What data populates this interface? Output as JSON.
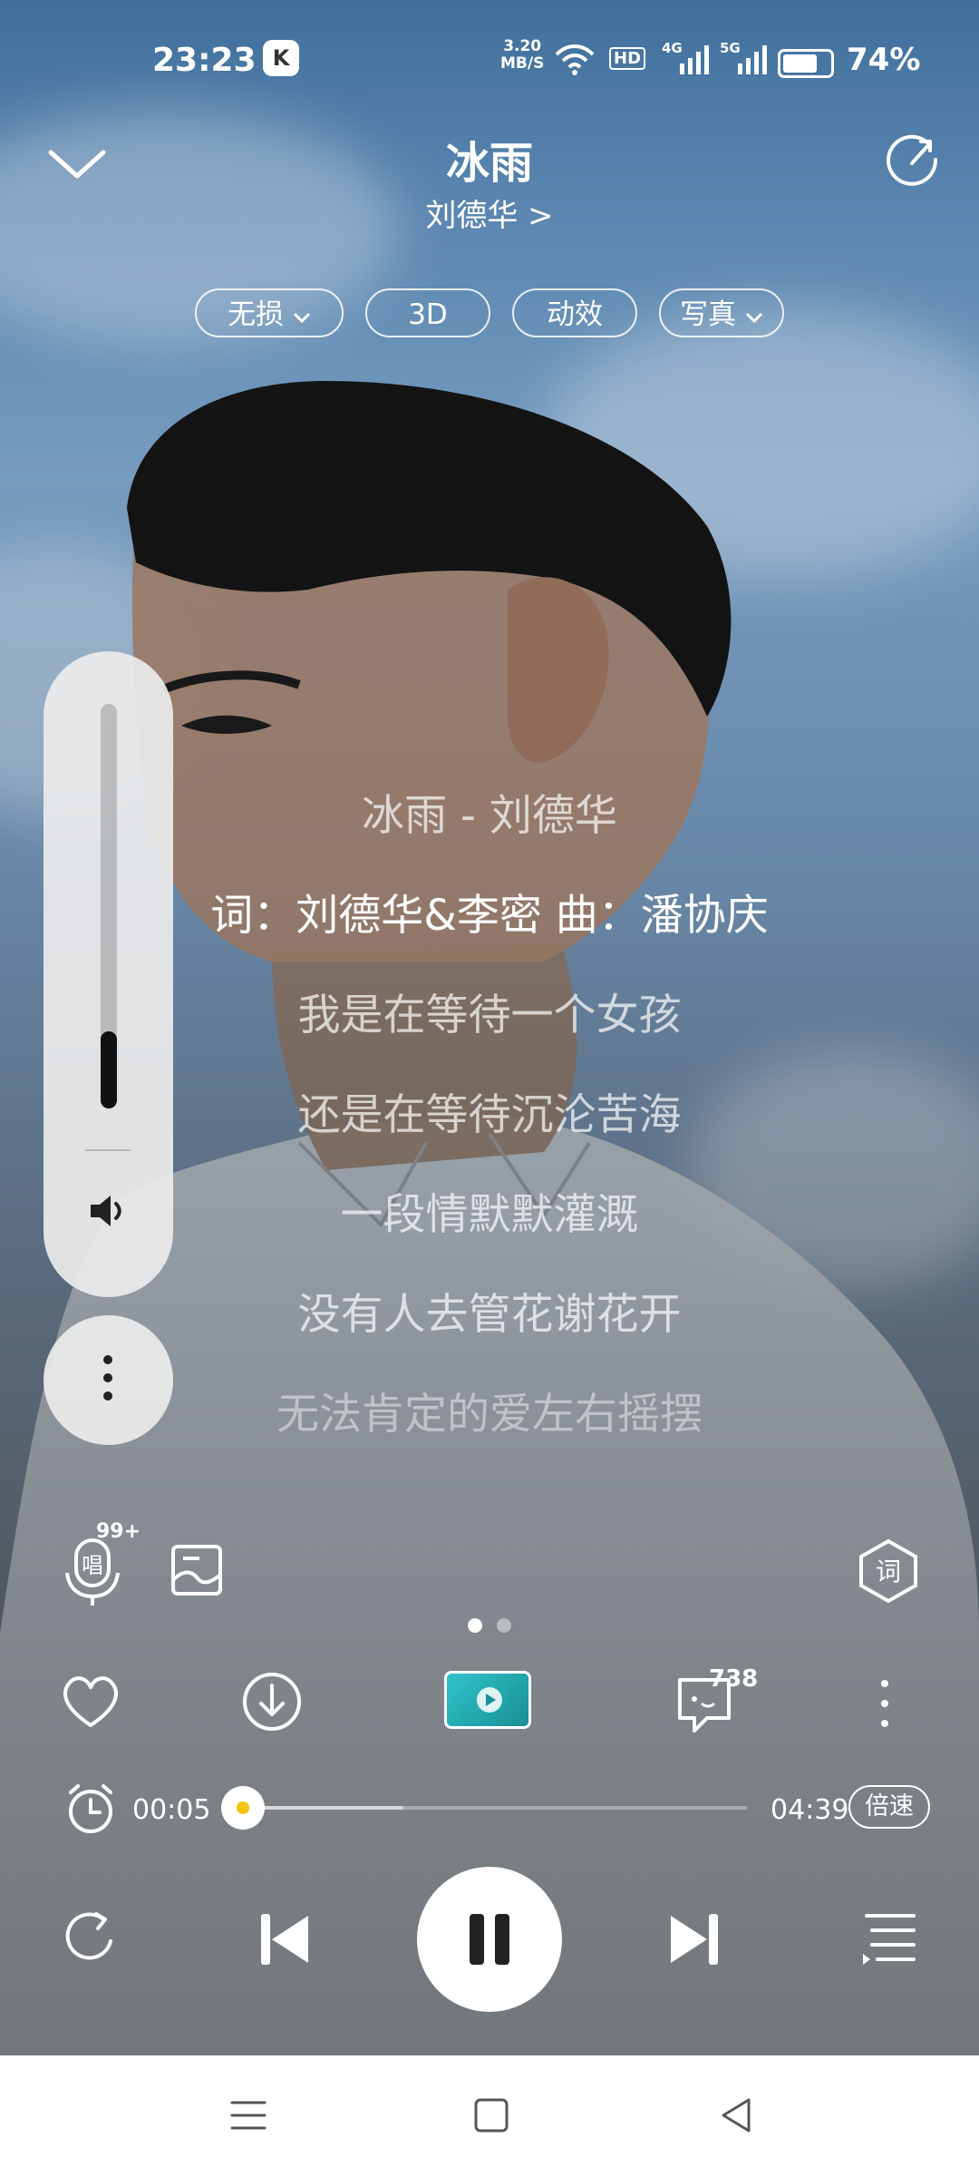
{
  "status_bar": {
    "time": "23:23",
    "net_speed_top": "3.20",
    "net_speed_unit": "MB/S",
    "hd_label": "HD",
    "sig1_label": "4G",
    "sig2_label": "5G",
    "battery_pct": "74%",
    "battery_level": 0.74
  },
  "header": {
    "title": "冰雨",
    "artist": "刘德华 >"
  },
  "chips": {
    "lossless": "无损",
    "three_d": "3D",
    "effect": "动效",
    "photo": "写真"
  },
  "lyrics": [
    {
      "text": "冰雨 - 刘德华",
      "active": false
    },
    {
      "text": "词：刘德华&李密 曲：潘协庆",
      "active": true
    },
    {
      "text": "我是在等待一个女孩",
      "active": false
    },
    {
      "text": "还是在等待沉沦苦海",
      "active": false
    },
    {
      "text": "一段情默默灌溉",
      "active": false
    },
    {
      "text": "没有人去管花谢花开",
      "active": false
    },
    {
      "text": "无法肯定的爱左右摇摆",
      "active": false
    }
  ],
  "volume": {
    "level": 0.19
  },
  "tools": {
    "sing_label": "唱",
    "sing_badge": "99+",
    "lyrics_toggle": "词"
  },
  "pager": {
    "total": 2,
    "current": 0
  },
  "actions": {
    "comment_count": "738"
  },
  "progress": {
    "current": "00:05",
    "total": "04:39",
    "played_fraction": 0.018,
    "buffered_fraction": 0.33,
    "speed_label": "倍速"
  },
  "colors": {
    "accent_knob": "#f2c40d",
    "panel_bg": "#ebebeb"
  },
  "icons": {
    "collapse": "chevron-down-icon",
    "share": "share-icon",
    "like": "heart-icon",
    "download": "download-icon",
    "comment": "comment-icon",
    "timer": "alarm-clock-icon",
    "repeat": "repeat-icon",
    "prev": "skip-previous-icon",
    "next": "skip-next-icon",
    "playlist": "playlist-icon"
  }
}
